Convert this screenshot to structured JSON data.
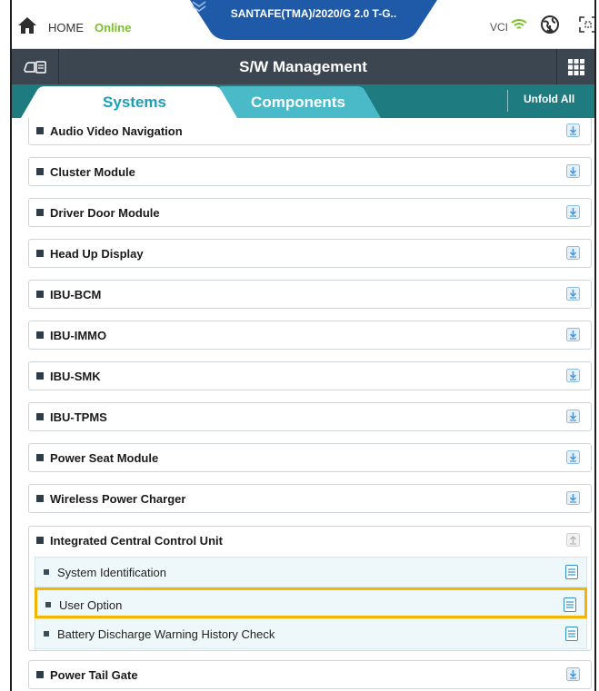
{
  "topbar": {
    "home_label": "HOME",
    "status_label": "Online",
    "vehicle": "SANTAFE(TMA)/2020/G 2.0 T-G..",
    "vci_label": "VCI",
    "colors": {
      "status": "#7ac02a",
      "vehicle_tab": "#1f5aa8"
    }
  },
  "titlebar": {
    "title": "S/W Management"
  },
  "tabs": {
    "systems": "Systems",
    "components": "Components",
    "unfold_all": "Unfold All"
  },
  "systems": [
    {
      "label": "Audio Video Navigation"
    },
    {
      "label": "Cluster Module"
    },
    {
      "label": "Driver Door Module"
    },
    {
      "label": "Head Up Display"
    },
    {
      "label": "IBU-BCM"
    },
    {
      "label": "IBU-IMMO"
    },
    {
      "label": "IBU-SMK"
    },
    {
      "label": "IBU-TPMS"
    },
    {
      "label": "Power Seat Module"
    },
    {
      "label": "Wireless Power Charger"
    }
  ],
  "expanded": {
    "label": "Integrated Central Control Unit",
    "items": [
      {
        "label": "System Identification"
      },
      {
        "label": "User Option"
      },
      {
        "label": "Battery Discharge Warning History Check"
      }
    ]
  },
  "after": [
    {
      "label": "Power Tail Gate"
    }
  ]
}
